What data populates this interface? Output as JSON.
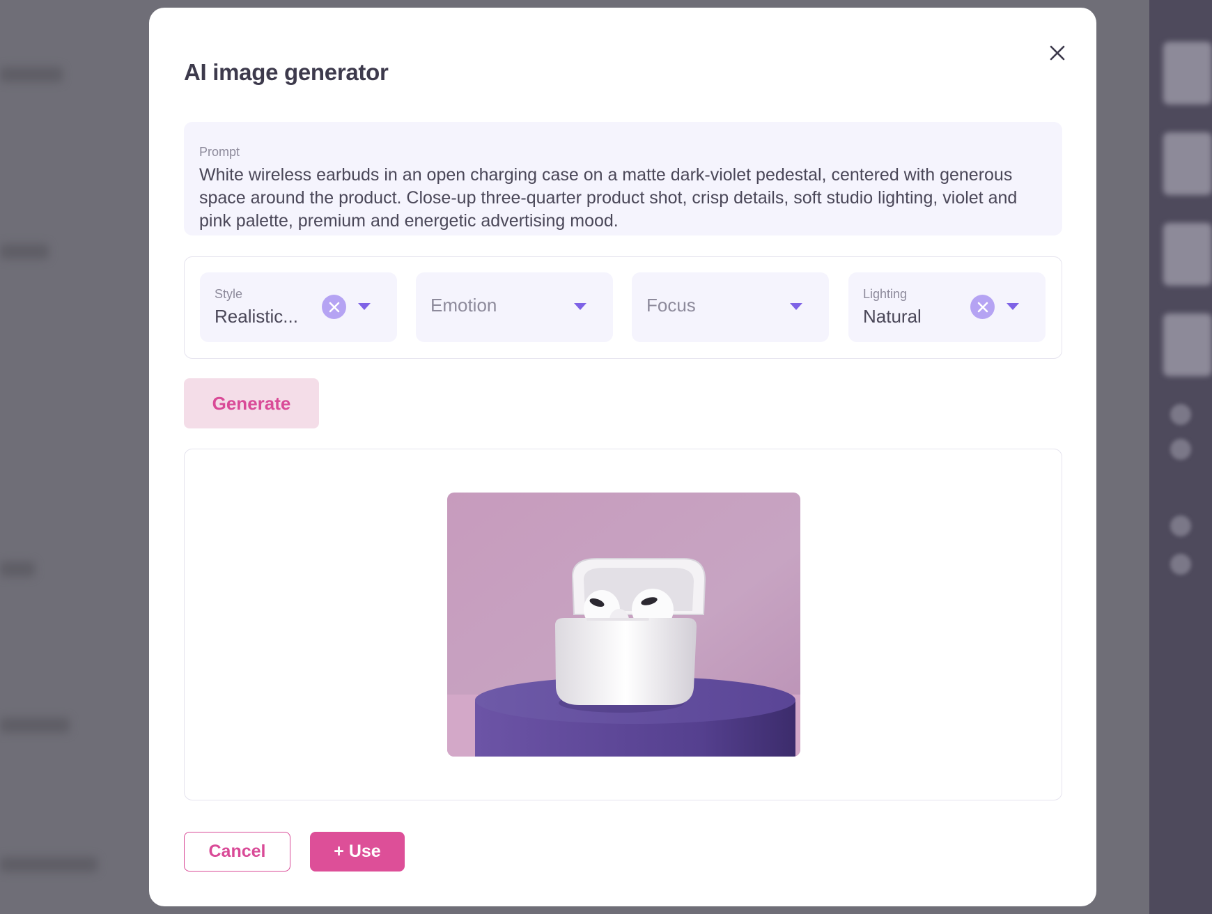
{
  "modal": {
    "title": "AI image generator",
    "close_icon": "close-icon"
  },
  "prompt": {
    "label": "Prompt",
    "value": "White wireless earbuds in an open charging case on a matte dark-violet pedestal, centered with generous space around the product. Close-up three-quarter product shot, crisp details, soft studio lighting, violet and pink palette, premium and energetic advertising mood."
  },
  "options": {
    "style": {
      "label": "Style",
      "value": "Realistic..."
    },
    "emotion": {
      "placeholder": "Emotion"
    },
    "focus": {
      "placeholder": "Focus"
    },
    "lighting": {
      "label": "Lighting",
      "value": "Natural"
    }
  },
  "actions": {
    "generate": "Generate",
    "cancel": "Cancel",
    "use": "+ Use"
  },
  "colors": {
    "accent_pink": "#dd4f98",
    "accent_violet": "#7e62e6",
    "field_bg": "#f5f4fd"
  }
}
